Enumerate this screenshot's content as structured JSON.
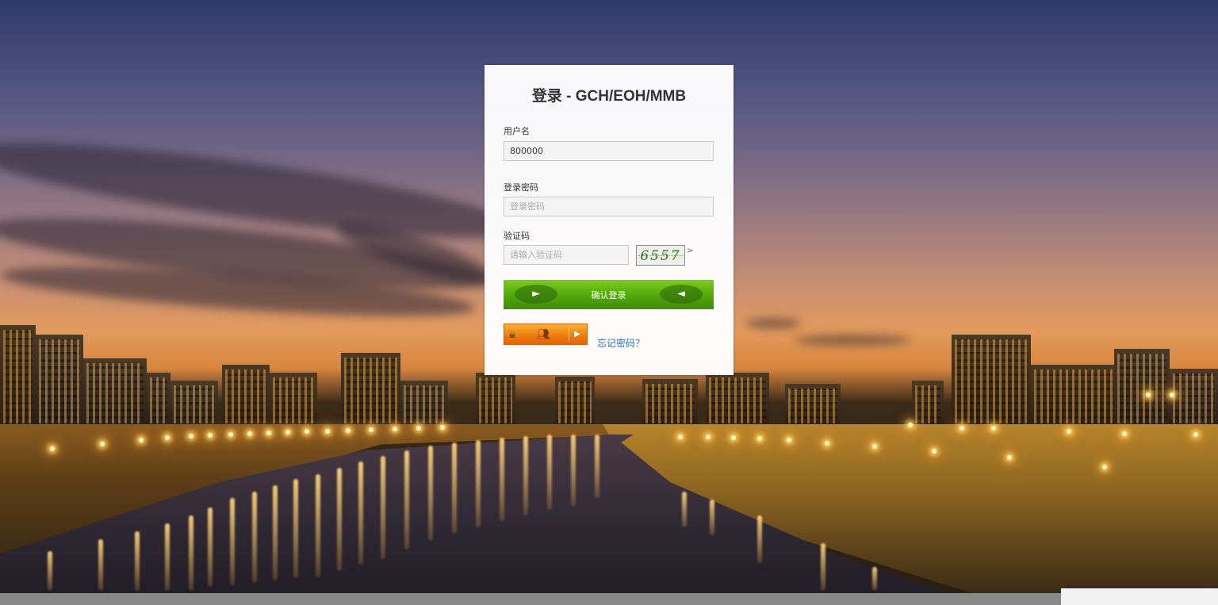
{
  "login": {
    "title": "登录 - GCH/EOH/MMB",
    "username_label": "用户名",
    "username_value": "800000",
    "password_label": "登录密码",
    "password_placeholder": "登录密码",
    "captcha_label": "验证码",
    "captcha_placeholder": "请输入验证码",
    "captcha_code": "6557",
    "captcha_refresh": ">",
    "submit_label": "确认登录",
    "submit_left_arrow": "►",
    "submit_right_arrow": "◄",
    "forgot_label": "忘记密码？"
  },
  "icons": {
    "lock": "lock-icon",
    "people": "people-icon",
    "play": "play-icon"
  },
  "colors": {
    "button_green": "#56ab0e",
    "badge_orange": "#ee7d10",
    "link_blue": "#2a6fb3"
  }
}
